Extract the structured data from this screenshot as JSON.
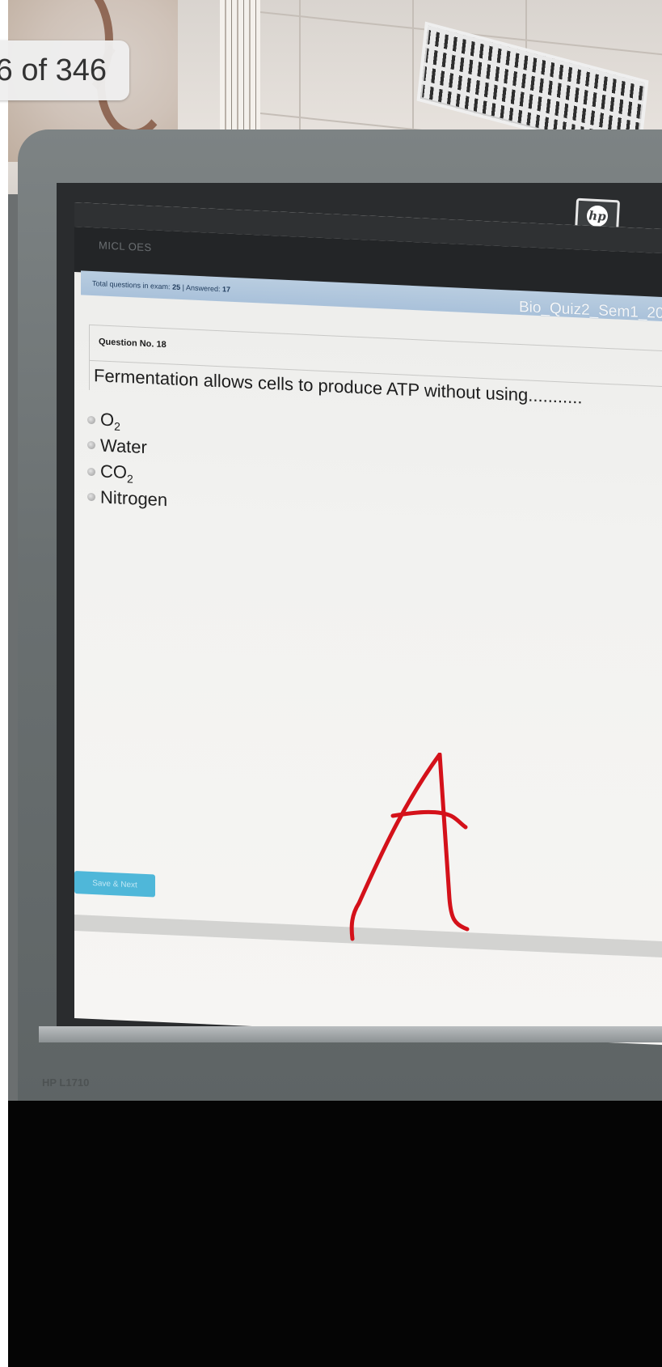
{
  "viewer": {
    "page_counter": "6 of 346"
  },
  "monitor": {
    "brand_logo": "hp",
    "model_label": "HP L1710"
  },
  "exam_app": {
    "app_title": "MICL OES",
    "info": {
      "total_label": "Total questions in exam:",
      "total_value": "25",
      "separator": "|",
      "answered_label": "Answered:",
      "answered_value": "17"
    },
    "exam_name": "Bio_Quiz2_Sem1_20",
    "question": {
      "number_label": "Question No. 18",
      "text": "Fermentation allows cells to produce ATP without using..........."
    },
    "options": [
      {
        "base": "O",
        "sub": "2",
        "selected": false
      },
      {
        "base": "Water",
        "sub": "",
        "selected": false
      },
      {
        "base": "CO",
        "sub": "2",
        "selected": false
      },
      {
        "base": "Nitrogen",
        "sub": "",
        "selected": false
      }
    ],
    "save_button_label": "Save & Next"
  },
  "annotation": {
    "text": "A",
    "color": "#d4111a"
  },
  "colors": {
    "info_bar": "#a9c1da",
    "button": "#4fb7d9",
    "floor": "#050505"
  }
}
